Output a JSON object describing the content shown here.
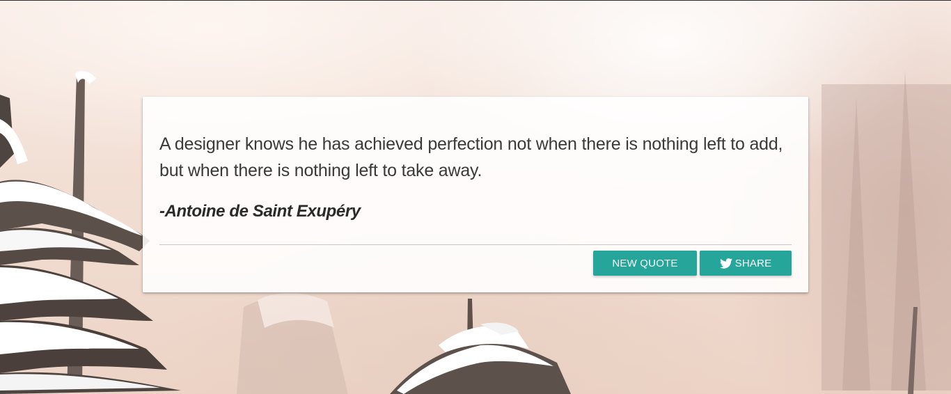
{
  "quote": {
    "text": "A designer knows he has achieved perfection not when there is nothing left to add, but when there is nothing left to take away.",
    "author": "-Antoine de Saint Exupéry"
  },
  "actions": {
    "new_quote_label": "NEW QUOTE",
    "share_label": "SHARE",
    "share_icon": "twitter-icon"
  },
  "colors": {
    "button": "#26a69a",
    "card": "#ffffff",
    "quote_text": "#3a3a3a"
  }
}
